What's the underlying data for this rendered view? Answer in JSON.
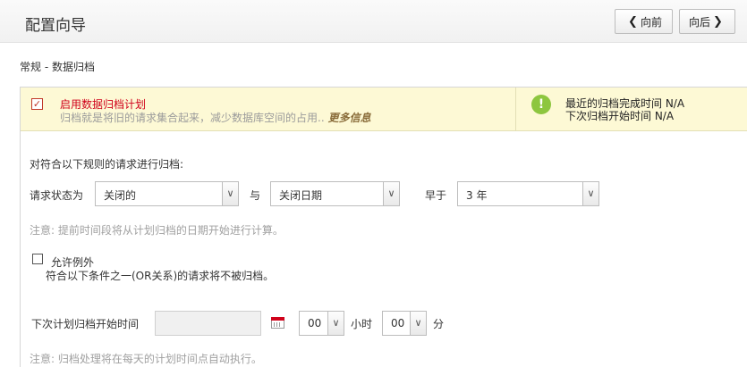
{
  "header": {
    "title": "配置向导",
    "prev_label": "向前",
    "next_label": "向后"
  },
  "breadcrumb": "常规 - 数据归档",
  "banner": {
    "enable_label": "启用数据归档计划",
    "enable_desc": "归档就是将旧的请求集合起来，减少数据库空间的占用..",
    "more_info": "更多信息",
    "last_complete": "最近的归档完成时间 N/A",
    "next_start": "下次归档开始时间 N/A"
  },
  "rule": {
    "title": "对符合以下规则的请求进行归档:",
    "status_label": "请求状态为",
    "status_value": "关闭的",
    "and_label": "与",
    "date_field_value": "关闭日期",
    "earlier_label": "早于",
    "period_value": "3 年",
    "note": "注意: 提前时间段将从计划归档的日期开始进行计算。"
  },
  "exception": {
    "label": "允许例外",
    "desc": "符合以下条件之一(OR关系)的请求将不被归档。"
  },
  "schedule": {
    "label": "下次计划归档开始时间",
    "date_value": "",
    "hour_value": "00",
    "hour_unit": "小时",
    "minute_value": "00",
    "minute_unit": "分",
    "note": "注意: 归档处理将在每天的计划时间点自动执行。"
  },
  "colors": {
    "warning_text": "#d0021b",
    "banner_bg": "#fdf9d5",
    "info_icon": "#8dc63f"
  },
  "icons": [
    "chevron-left-icon",
    "chevron-right-icon",
    "checkbox-checked-icon",
    "info-icon",
    "calendar-icon",
    "dropdown-arrow-icon"
  ]
}
